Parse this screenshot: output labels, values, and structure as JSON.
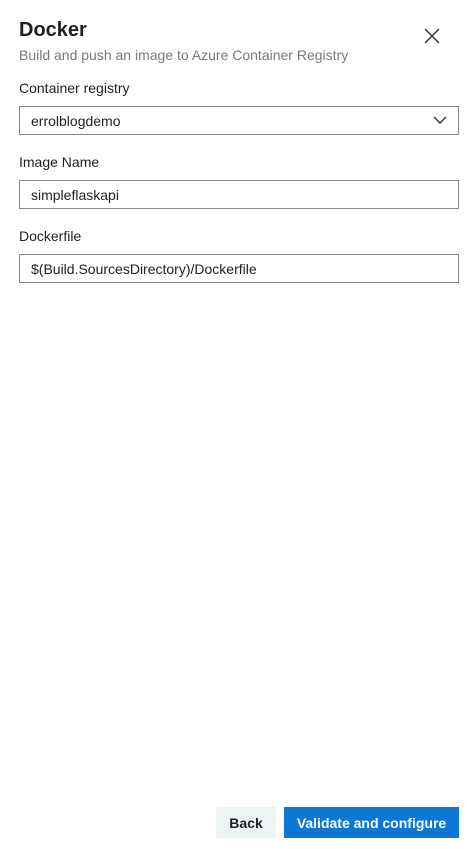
{
  "header": {
    "title": "Docker",
    "subtitle": "Build and push an image to Azure Container Registry"
  },
  "icons": {
    "close": "close-icon",
    "dropdown": "chevron-down-icon"
  },
  "form": {
    "container_registry": {
      "label": "Container registry",
      "value": "errolblogdemo"
    },
    "image_name": {
      "label": "Image Name",
      "value": "simpleflaskapi"
    },
    "dockerfile": {
      "label": "Dockerfile",
      "value": "$(Build.SourcesDirectory)/Dockerfile"
    }
  },
  "footer": {
    "back_label": "Back",
    "primary_label": "Validate and configure"
  },
  "colors": {
    "primary": "#0a78d4",
    "secondary_button_bg": "#eef4f6",
    "border": "#8a8886",
    "subtitle_text": "#7a7977"
  }
}
